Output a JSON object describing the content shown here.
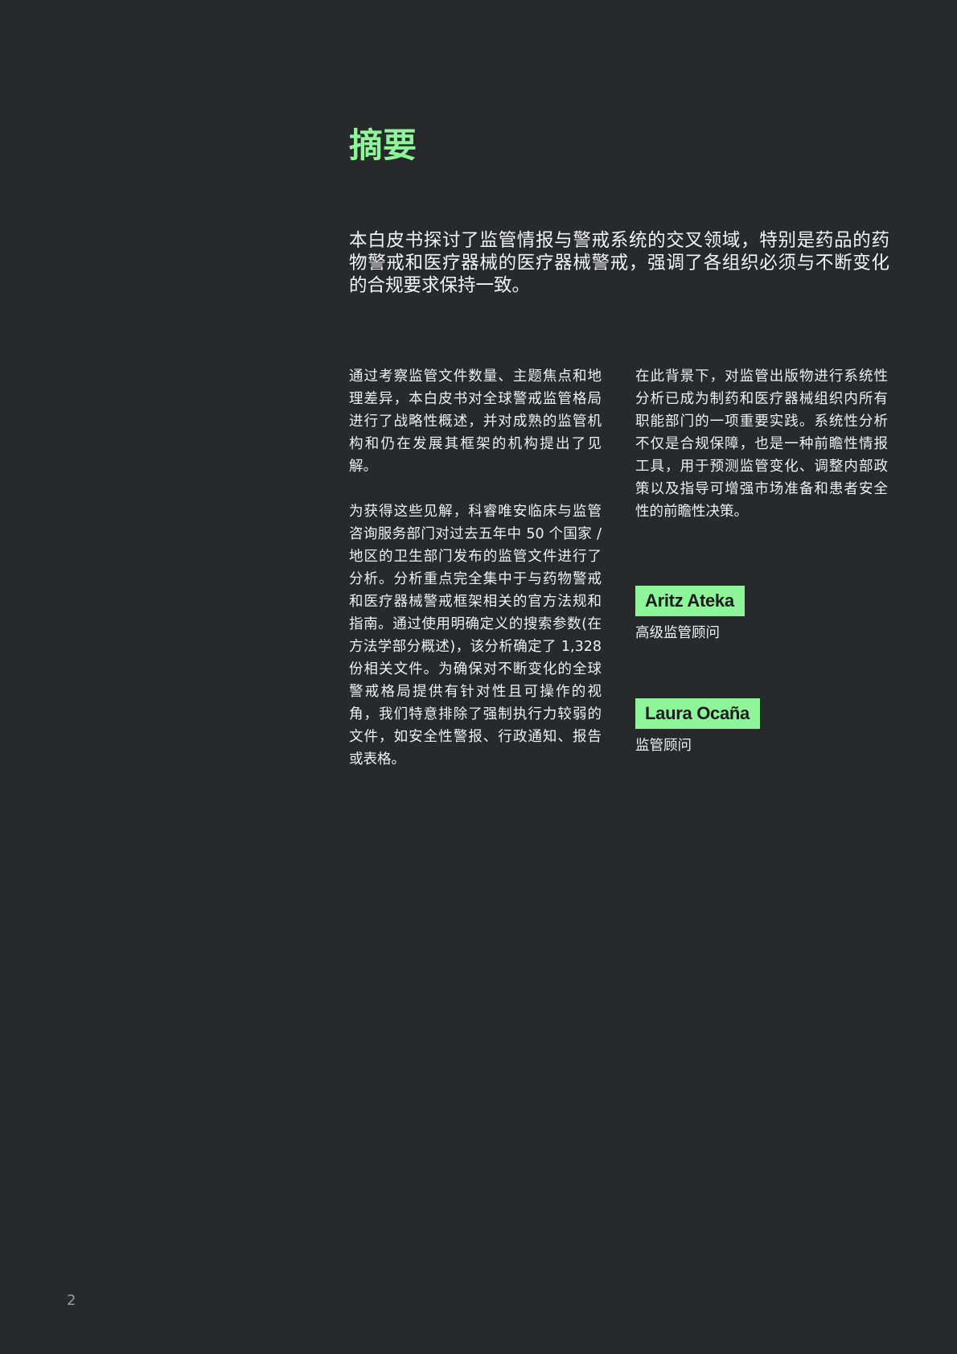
{
  "page": {
    "title": "摘要",
    "lead": "本白皮书探讨了监管情报与警戒系统的交叉领域，特别是药品的药物警戒和医疗器械的医疗器械警戒，强调了各组织必须与不断变化的合规要求保持一致。",
    "page_number": "2"
  },
  "left_column": {
    "paragraphs": [
      "通过考察监管文件数量、主题焦点和地理差异，本白皮书对全球警戒监管格局进行了战略性概述，并对成熟的监管机构和仍在发展其框架的机构提出了见解。",
      "为获得这些见解，科睿唯安临床与监管咨询服务部门对过去五年中 50 个国家 / 地区的卫生部门发布的监管文件进行了分析。分析重点完全集中于与药物警戒和医疗器械警戒框架相关的官方法规和指南。通过使用明确定义的搜索参数(在方法学部分概述)，该分析确定了 1,328 份相关文件。为确保对不断变化的全球警戒格局提供有针对性且可操作的视角，我们特意排除了强制执行力较弱的文件，如安全性警报、行政通知、报告或表格。"
    ]
  },
  "right_column": {
    "paragraph": "在此背景下，对监管出版物进行系统性分析已成为制药和医疗器械组织内所有职能部门的一项重要实践。系统性分析不仅是合规保障，也是一种前瞻性情报工具，用于预测监管变化、调整内部政策以及指导可增强市场准备和患者安全性的前瞻性决策。"
  },
  "authors": [
    {
      "name": "Aritz Ateka",
      "role": "高级监管顾问"
    },
    {
      "name": "Laura Ocaña",
      "role": "监管顾问"
    }
  ],
  "colors": {
    "background": "#28292b",
    "accent": "#8ef59b",
    "text": "#f2f2f2"
  }
}
